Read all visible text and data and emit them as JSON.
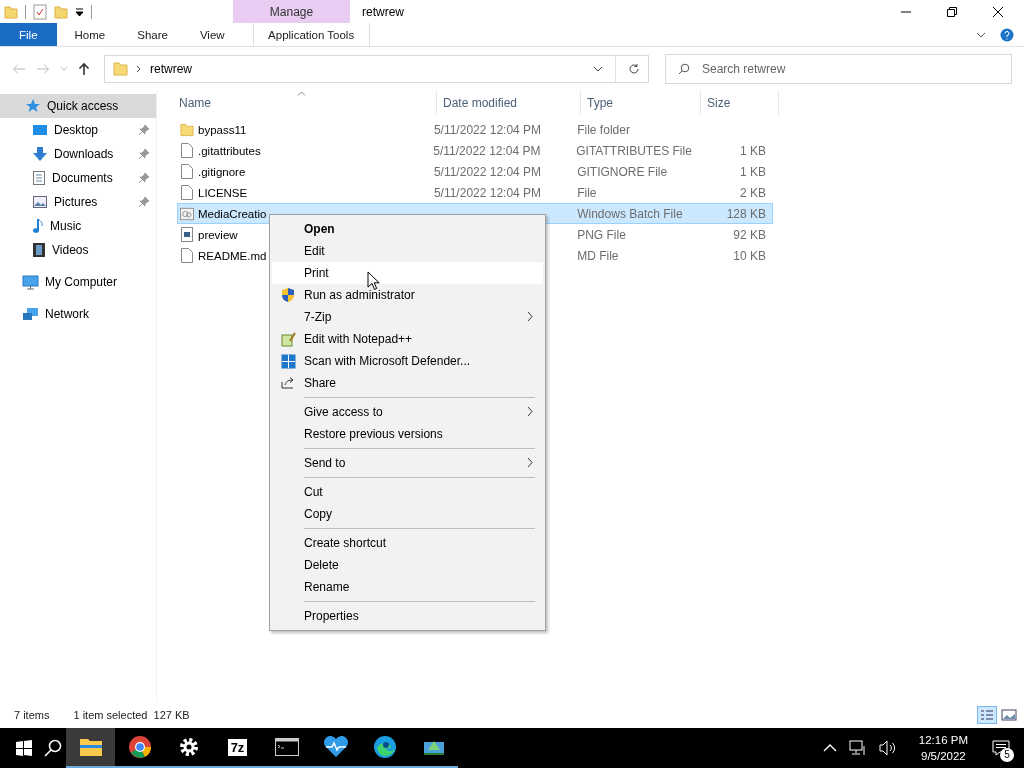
{
  "window": {
    "title": "retwrew",
    "context_tab": "Manage"
  },
  "ribbon_tabs": [
    {
      "label": "File",
      "kind": "file",
      "selected": false
    },
    {
      "label": "Home",
      "kind": "tab",
      "selected": false
    },
    {
      "label": "Share",
      "kind": "tab",
      "selected": false
    },
    {
      "label": "View",
      "kind": "tab",
      "selected": false
    },
    {
      "label": "Application Tools",
      "kind": "context",
      "selected": false
    }
  ],
  "address": {
    "path": "retwrew"
  },
  "search": {
    "placeholder": "Search retwrew"
  },
  "sidebar": {
    "items": [
      {
        "label": "Quick access",
        "selected": true,
        "children": [
          {
            "label": "Desktop",
            "selected": false,
            "pinned": true
          },
          {
            "label": "Downloads",
            "selected": false,
            "pinned": true
          },
          {
            "label": "Documents",
            "selected": false,
            "pinned": true
          },
          {
            "label": "Pictures",
            "selected": false,
            "pinned": true
          },
          {
            "label": "Music",
            "selected": false,
            "pinned": false
          },
          {
            "label": "Videos",
            "selected": false,
            "pinned": false
          }
        ]
      },
      {
        "label": "My Computer",
        "selected": false
      },
      {
        "label": "Network",
        "selected": false
      }
    ]
  },
  "table": {
    "columns": [
      "Name",
      "Date modified",
      "Type",
      "Size"
    ],
    "rows": [
      {
        "kind": "folder",
        "name": "bypass11",
        "date": "5/11/2022 12:04 PM",
        "type": "File folder",
        "selected": false
      },
      {
        "kind": "file",
        "name": ".gitattributes",
        "date": "5/11/2022 12:04 PM",
        "type": "GITATTRIBUTES File",
        "size": "1 KB",
        "selected": false
      },
      {
        "kind": "file",
        "name": ".gitignore",
        "date": "5/11/2022 12:04 PM",
        "type": "GITIGNORE File",
        "size": "1 KB",
        "selected": false
      },
      {
        "kind": "file",
        "name": "LICENSE",
        "date": "5/11/2022 12:04 PM",
        "type": "File",
        "size": "2 KB",
        "selected": false
      },
      {
        "kind": "batch",
        "name": "MediaCreatio",
        "type": "Windows Batch File",
        "size": "128 KB",
        "selected": true
      },
      {
        "kind": "image",
        "name": "preview",
        "type": "PNG File",
        "size": "92 KB",
        "selected": false
      },
      {
        "kind": "file",
        "name": "README.md",
        "type": "MD File",
        "size": "10 KB",
        "selected": false
      }
    ]
  },
  "context_menu": [
    {
      "kind": "item",
      "label": "Open",
      "bold": true,
      "submenu": false,
      "highlighted": false
    },
    {
      "kind": "item",
      "label": "Edit",
      "bold": false,
      "submenu": false,
      "highlighted": false
    },
    {
      "kind": "item",
      "label": "Print",
      "bold": false,
      "submenu": false,
      "highlighted": true
    },
    {
      "kind": "item",
      "label": "Run as administrator",
      "bold": false,
      "submenu": false,
      "highlighted": false
    },
    {
      "kind": "item",
      "label": "7-Zip",
      "bold": false,
      "submenu": true,
      "highlighted": false
    },
    {
      "kind": "item",
      "label": "Edit with Notepad++",
      "bold": false,
      "submenu": false,
      "highlighted": false
    },
    {
      "kind": "item",
      "label": "Scan with Microsoft Defender...",
      "bold": false,
      "submenu": false,
      "highlighted": false
    },
    {
      "kind": "item",
      "label": "Share",
      "bold": false,
      "submenu": false,
      "highlighted": false
    },
    {
      "kind": "separator"
    },
    {
      "kind": "item",
      "label": "Give access to",
      "bold": false,
      "submenu": true,
      "highlighted": false
    },
    {
      "kind": "item",
      "label": "Restore previous versions",
      "bold": false,
      "submenu": false,
      "highlighted": false
    },
    {
      "kind": "separator"
    },
    {
      "kind": "item",
      "label": "Send to",
      "bold": false,
      "submenu": true,
      "highlighted": false
    },
    {
      "kind": "separator"
    },
    {
      "kind": "item",
      "label": "Cut",
      "bold": false,
      "submenu": false,
      "highlighted": false
    },
    {
      "kind": "item",
      "label": "Copy",
      "bold": false,
      "submenu": false,
      "highlighted": false
    },
    {
      "kind": "separator"
    },
    {
      "kind": "item",
      "label": "Create shortcut",
      "bold": false,
      "submenu": false,
      "highlighted": false
    },
    {
      "kind": "item",
      "label": "Delete",
      "bold": false,
      "submenu": false,
      "highlighted": false
    },
    {
      "kind": "item",
      "label": "Rename",
      "bold": false,
      "submenu": false,
      "highlighted": false
    },
    {
      "kind": "separator"
    },
    {
      "kind": "item",
      "label": "Properties",
      "bold": false,
      "submenu": false,
      "highlighted": false
    }
  ],
  "status_bar": {
    "count": "7 items",
    "selection": "1 item selected  127 KB"
  },
  "taskbar": {
    "app_7z": "7z",
    "time": "12:16 PM",
    "date": "9/5/2022",
    "notifications": "5"
  }
}
